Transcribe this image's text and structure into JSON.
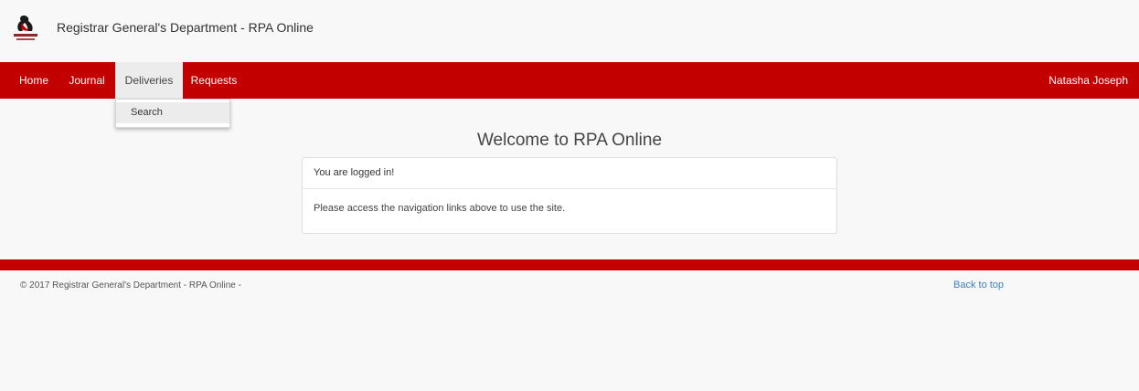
{
  "header": {
    "site_title": "Registrar General's Department - RPA Online",
    "logo_icon": "rgd-seal-icon"
  },
  "nav": {
    "items": [
      {
        "label": "Home",
        "active": false
      },
      {
        "label": "Journal",
        "active": false
      },
      {
        "label": "Deliveries",
        "active": true
      },
      {
        "label": "Requests",
        "active": false
      }
    ],
    "user_name": "Natasha Joseph"
  },
  "dropdown": {
    "items": [
      {
        "label": "Search"
      }
    ]
  },
  "main": {
    "welcome_title": "Welcome to RPA Online",
    "panel_heading": "You are logged in!",
    "panel_body": "Please access the navigation links above to use the site."
  },
  "footer": {
    "copyright": "© 2017 Registrar General's Department - RPA Online -",
    "back_to_top": "Back to top"
  },
  "colors": {
    "brand_red": "#c30000",
    "link_blue": "#3b80c7"
  }
}
